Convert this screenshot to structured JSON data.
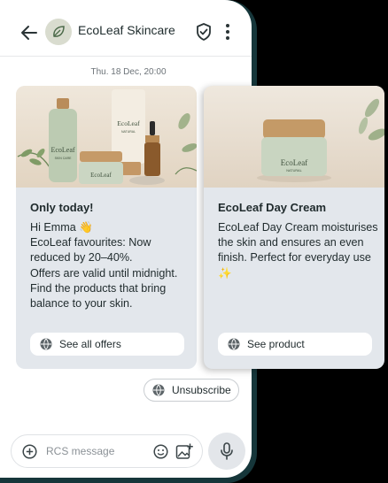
{
  "header": {
    "title": "EcoLeaf Skincare",
    "back_icon": "back-arrow-icon",
    "avatar_icon": "leaf-icon",
    "verified_icon": "shield-check-icon",
    "menu_icon": "more-vertical-icon"
  },
  "timestamp": "Thu. 18 Dec, 20:00",
  "cards": [
    {
      "image": "product-collection-photo",
      "image_texts": [
        "EcoLeaf",
        "SKIN CARE",
        "EcoLeaf",
        "NATURAL",
        "EcoLeaf"
      ],
      "title": "Only today!",
      "body": "Hi Emma 👋\nEcoLeaf favourites: Now reduced by 20–40%.\nOffers are valid until midnight. Find the products that bring balance to your skin.",
      "action": "See all offers",
      "action_icon": "globe-icon"
    },
    {
      "image": "day-cream-jar-photo",
      "image_texts": [
        "EcoLeaf",
        "NATURAL"
      ],
      "title": "EcoLeaf Day Cream",
      "body": "EcoLeaf Day Cream moisturises the skin and ensures an even finish. Perfect for everyday use ✨",
      "action": "See product",
      "action_icon": "globe-icon"
    }
  ],
  "unsubscribe": {
    "label": "Unsubscribe",
    "icon": "globe-icon"
  },
  "composer": {
    "placeholder": "RCS message",
    "add_icon": "plus-circle-icon",
    "emoji_icon": "emoji-icon",
    "gallery_icon": "image-add-icon",
    "mic_icon": "microphone-icon"
  },
  "colors": {
    "frame": "#16363a",
    "card_bg": "#e3e7ec",
    "image_bg": "#ece3d6",
    "leaf_green": "#5f7a5c"
  }
}
